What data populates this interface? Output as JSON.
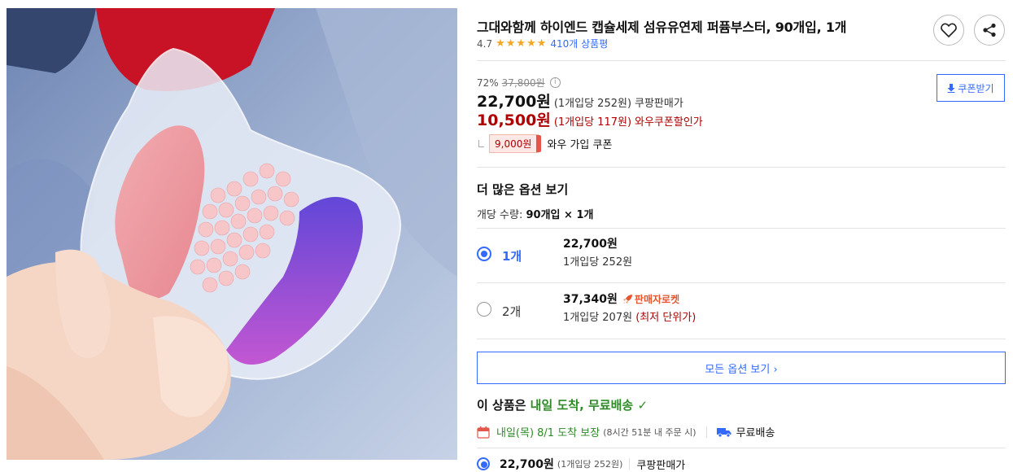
{
  "product": {
    "image_alt": "",
    "title": "그대와함께 하이엔드 캡슐세제 섬유유연제 퍼퓸부스터, 90개입, 1개",
    "rating_score": "4.7",
    "rating_stars": 5,
    "review_count_label": "410개 상품평",
    "wishlist_icon": "heart-icon",
    "share_icon": "share-icon"
  },
  "pricing": {
    "discount_rate": "72%",
    "original_price": "37,800원",
    "info_icon": "ⓘ",
    "coupon_button_label": "쿠폰받기",
    "coupon_button_icon": "download-icon",
    "sale_price": "22,700원",
    "sale_unit": "(1개입당 252원)",
    "sale_type": "쿠팡판매가",
    "wow_price": "10,500원",
    "wow_unit": "(1개입당 117원)",
    "wow_type": "와우쿠폰할인가",
    "wow_coupon_amount": "9,000원",
    "wow_coupon_label": "와우 가입 쿠폰"
  },
  "options": {
    "section_title": "더 많은 옵션 보기",
    "qty_label": "개당 수량: ",
    "qty_value": "90개입 × 1개",
    "items": [
      {
        "label": "1개",
        "price": "22,700원",
        "unit": "1개입당 252원",
        "lowest": "",
        "badge": "",
        "selected": true
      },
      {
        "label": "2개",
        "price": "37,340원",
        "unit": "1개입당 207원 ",
        "lowest": "(최저 단위가)",
        "badge": "판매자로켓",
        "selected": false
      }
    ],
    "all_options_label": "모든 옵션 보기 ›"
  },
  "delivery": {
    "headline_prefix": "이 상품은 ",
    "headline_green": "내일 도착, 무료배송",
    "check_icon": "✓",
    "arrival_date": "내일(목) 8/1 도착 보장",
    "arrival_note": "(8시간 51분 내 주문 시)",
    "free_shipping": "무료배송",
    "bottom_price": "22,700원",
    "bottom_unit": "(1개입당 252원)",
    "bottom_type": "쿠팡판매가"
  },
  "colors": {
    "accent_blue": "#346aff",
    "wow_red": "#ae0000",
    "green": "#2e8b27",
    "star": "#f5a623"
  }
}
